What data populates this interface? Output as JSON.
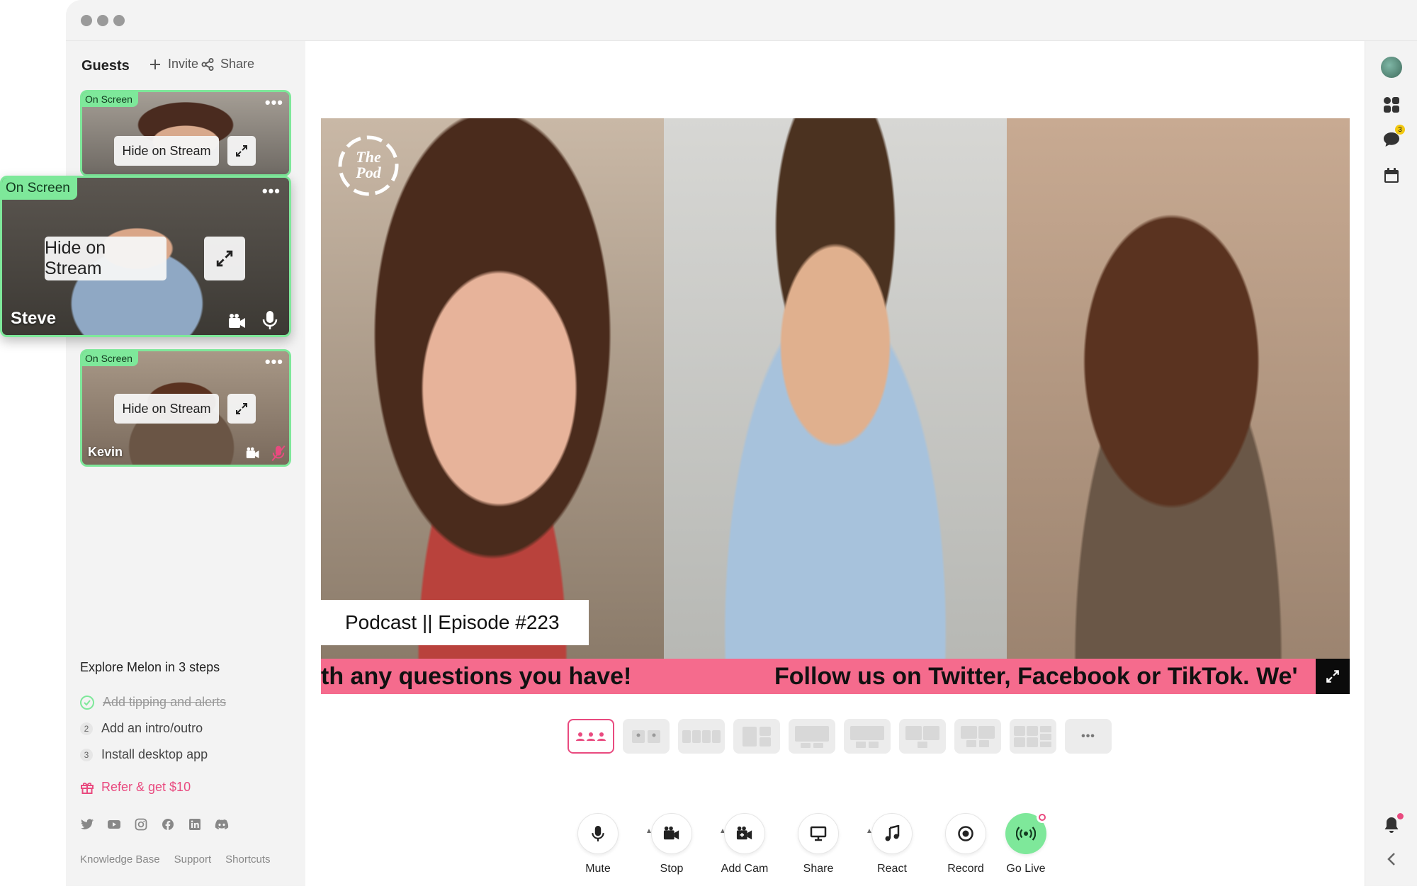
{
  "sidebar": {
    "title": "Guests",
    "invite_label": "Invite",
    "share_label": "Share",
    "guests": [
      {
        "badge": "On Screen",
        "hide_label": "Hide on Stream",
        "name": ""
      },
      {
        "badge": "On Screen",
        "hide_label": "Hide on Stream",
        "name": "Steve"
      },
      {
        "badge": "On Screen",
        "hide_label": "Hide on Stream",
        "name": "Kevin"
      }
    ],
    "more_label": "•••",
    "explore": {
      "title": "Explore Melon in 3 steps",
      "steps": [
        {
          "num": "",
          "label": "Add tipping and alerts",
          "done": true
        },
        {
          "num": "2",
          "label": "Add an intro/outro",
          "done": false
        },
        {
          "num": "3",
          "label": "Install desktop app",
          "done": false
        }
      ]
    },
    "refer_label": "Refer & get $10",
    "socials": [
      "twitter-icon",
      "youtube-icon",
      "instagram-icon",
      "facebook-icon",
      "linkedin-icon",
      "discord-icon"
    ],
    "footer_links": [
      "Knowledge Base",
      "Support",
      "Shortcuts"
    ]
  },
  "stage": {
    "logo_text": "The Pod",
    "lower_third": "Podcast || Episode #223",
    "ticker_left": "th any questions you have!",
    "ticker_right": "Follow us on Twitter, Facebook or TikTok. We'"
  },
  "layouts_more": "•••",
  "controls": {
    "mute": "Mute",
    "stop": "Stop",
    "add_cam": "Add Cam",
    "share": "Share",
    "react": "React",
    "record": "Record",
    "go_live": "Go Live"
  },
  "rail": {
    "chat_badge": "3"
  },
  "colors": {
    "accent_green": "#7ee89a",
    "accent_pink": "#e94a7f",
    "ticker_bg": "#f56b8d"
  }
}
